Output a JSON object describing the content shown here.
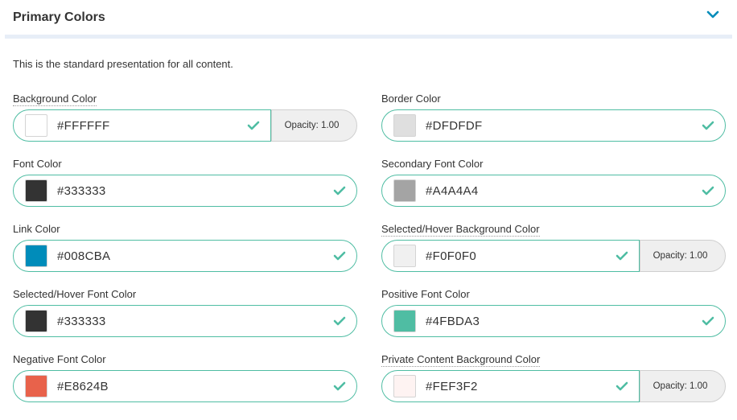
{
  "section": {
    "title": "Primary Colors",
    "description": "This is the standard presentation for all content."
  },
  "accent_color": "#4FBDA3",
  "chevron_color": "#008CBA",
  "icons": {
    "collapse": "chevron-down-icon",
    "valid": "checkmark-icon"
  },
  "fields": [
    {
      "label": "Background Color",
      "value": "#FFFFFF",
      "swatch": "#FFFFFF",
      "opacity": "Opacity: 1.00"
    },
    {
      "label": "Border Color",
      "value": "#DFDFDF",
      "swatch": "#DFDFDF"
    },
    {
      "label": "Font Color",
      "value": "#333333",
      "swatch": "#333333"
    },
    {
      "label": "Secondary Font Color",
      "value": "#A4A4A4",
      "swatch": "#A4A4A4"
    },
    {
      "label": "Link Color",
      "value": "#008CBA",
      "swatch": "#008CBA"
    },
    {
      "label": "Selected/Hover Background Color",
      "value": "#F0F0F0",
      "swatch": "#F0F0F0",
      "opacity": "Opacity: 1.00"
    },
    {
      "label": "Selected/Hover Font Color",
      "value": "#333333",
      "swatch": "#333333"
    },
    {
      "label": "Positive Font Color",
      "value": "#4FBDA3",
      "swatch": "#4FBDA3"
    },
    {
      "label": "Negative Font Color",
      "value": "#E8624B",
      "swatch": "#E8624B"
    },
    {
      "label": "Private Content Background Color",
      "value": "#FEF3F2",
      "swatch": "#FEF3F2",
      "opacity": "Opacity: 1.00"
    }
  ]
}
